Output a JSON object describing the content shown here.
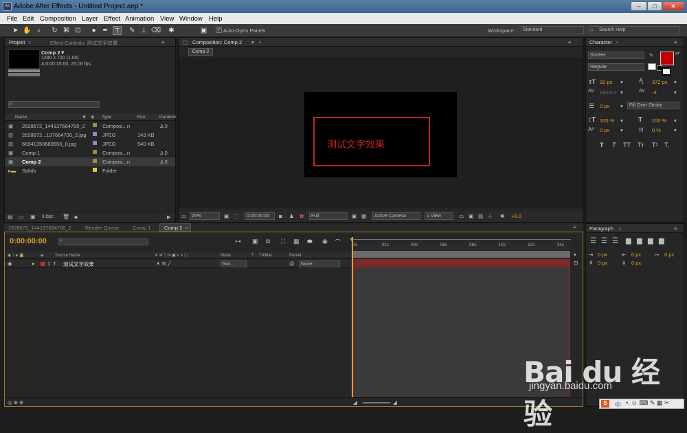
{
  "window": {
    "title": "Adobe After Effects - Untitled Project.aep *",
    "app_icon": "Ae",
    "minimize": "–",
    "maximize": "□",
    "close": "✕"
  },
  "menu": [
    "File",
    "Edit",
    "Composition",
    "Layer",
    "Effect",
    "Animation",
    "View",
    "Window",
    "Help"
  ],
  "toolbar": {
    "auto_open": "Auto-Open Panels",
    "workspace_label": "Workspace:",
    "workspace_value": "Standard",
    "search_placeholder": "Search Help"
  },
  "project": {
    "tab": "Project",
    "effect_tab": "Effect Controls: 测试文字效果",
    "comp_name": "Comp 2▼",
    "comp_dims": "1280 x 720 (1.00)",
    "comp_dur": "Δ 0:00:15:00, 25.00 fps",
    "columns": [
      "Name",
      "Type",
      "Size",
      "Duration"
    ],
    "items": [
      {
        "name": "2628672_144137664700_2",
        "type": "Composi...n",
        "size": "",
        "dur": "Δ 0",
        "color": "#a08a50",
        "icon": "comp-icon"
      },
      {
        "name": "2628672...137664700_2.jpg",
        "type": "JPEG",
        "size": "143 KB",
        "dur": "",
        "color": "#8a8ad0",
        "icon": "image-icon"
      },
      {
        "name": "66941350689550_0.jpg",
        "type": "JPEG",
        "size": "540 KB",
        "dur": "",
        "color": "#8a8ad0",
        "icon": "image-icon"
      },
      {
        "name": "Comp 1",
        "type": "Composi...n",
        "size": "",
        "dur": "Δ 0",
        "color": "#a08a50",
        "icon": "comp-icon"
      },
      {
        "name": "Comp 2",
        "type": "Composi...n",
        "size": "",
        "dur": "Δ 0",
        "color": "#a08a50",
        "icon": "comp-icon"
      },
      {
        "name": "Solids",
        "type": "Folder",
        "size": "",
        "dur": "",
        "color": "#d8c850",
        "icon": "folder-icon"
      }
    ],
    "bpc": "8 bpc"
  },
  "composition": {
    "tab": "Composition: Comp 2",
    "subtab": "Comp 2",
    "text": "测试文字效果",
    "zoom": "25%",
    "timecode": "0:00:00:00",
    "resolution": "Full",
    "camera": "Active Camera",
    "view": "1 View",
    "exposure": "+0.0"
  },
  "character": {
    "tab": "Character",
    "font": "SimHei",
    "style": "Regular",
    "size": "92 px",
    "leading": "372 px",
    "kerning": "Metrics",
    "tracking": "-3",
    "stroke_width": "0 px",
    "stroke_type": "Fill Over Stroke",
    "vscale": "100 %",
    "hscale": "100 %",
    "baseline": "0 px",
    "tsume": "0 %",
    "styles": [
      "T",
      "T",
      "TT",
      "Tт",
      "T¹",
      "T,"
    ],
    "fill_color": "#c00000"
  },
  "paragraph": {
    "tab": "Paragraph",
    "indent_left": "0 px",
    "indent_first": "0 px",
    "indent_right": "0 px",
    "space_before": "0 px",
    "space_after": "0 px"
  },
  "timeline": {
    "tabs": [
      "2628672_144137664700_2",
      "Render Queue",
      "Comp 1",
      "Comp 2"
    ],
    "timecode": "0:00:00:00",
    "cols": {
      "source": "Source Name",
      "mode": "Mode",
      "t": "T",
      "trkmat": "TrkMat",
      "parent": "Parent"
    },
    "layer": {
      "num": "1",
      "name": "测试文字效果",
      "mode": "Nor...",
      "parent": "None"
    },
    "ruler": [
      "0s",
      "02s",
      "04s",
      "06s",
      "08s",
      "10s",
      "12s",
      "14s"
    ]
  },
  "watermark": {
    "brand": "Bai du 经验",
    "url": "jingyan.baidu.com"
  },
  "tray": {
    "ime": "中"
  }
}
